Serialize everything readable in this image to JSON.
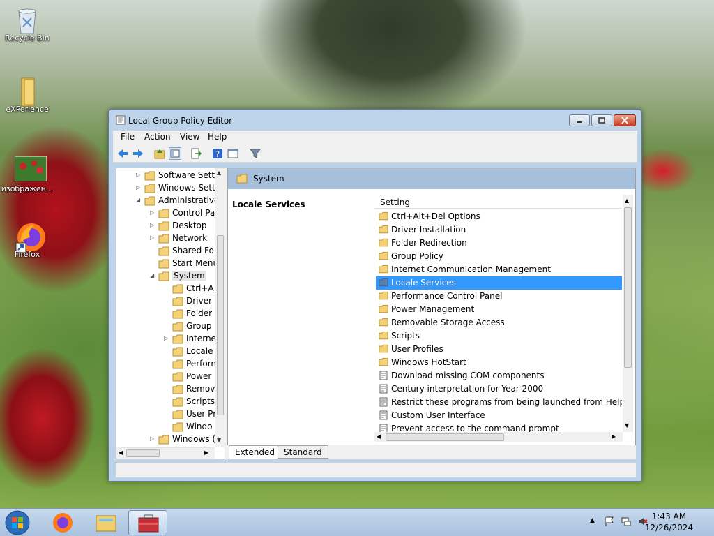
{
  "desktop": {
    "icons": [
      {
        "label": "Recycle Bin",
        "icon": "recycle-bin-icon"
      },
      {
        "label": "eXPerience",
        "icon": "folder-icon"
      },
      {
        "label": "изображен...",
        "icon": "image-icon"
      },
      {
        "label": "Firefox",
        "icon": "firefox-icon"
      }
    ]
  },
  "window": {
    "title": "Local Group Policy Editor",
    "menu": [
      "File",
      "Action",
      "View",
      "Help"
    ],
    "tree": [
      {
        "label": "Software Setti",
        "arrow": "▷"
      },
      {
        "label": "Windows Sett",
        "arrow": "▷"
      },
      {
        "label": "Administrative",
        "arrow": "◢"
      },
      {
        "label": "Control Pa",
        "arrow": "▷"
      },
      {
        "label": "Desktop",
        "arrow": "▷"
      },
      {
        "label": "Network",
        "arrow": "▷"
      },
      {
        "label": "Shared Fol",
        "arrow": ""
      },
      {
        "label": "Start Menu",
        "arrow": ""
      },
      {
        "label": "System",
        "arrow": "◢"
      },
      {
        "label": "Ctrl+A",
        "arrow": ""
      },
      {
        "label": "Driver",
        "arrow": ""
      },
      {
        "label": "Folder",
        "arrow": ""
      },
      {
        "label": "Group",
        "arrow": ""
      },
      {
        "label": "Interne",
        "arrow": "▷"
      },
      {
        "label": "Locale",
        "arrow": ""
      },
      {
        "label": "Perforn",
        "arrow": ""
      },
      {
        "label": "Power",
        "arrow": ""
      },
      {
        "label": "Remov",
        "arrow": ""
      },
      {
        "label": "Scripts",
        "arrow": ""
      },
      {
        "label": "User Pr",
        "arrow": ""
      },
      {
        "label": "Windo",
        "arrow": ""
      },
      {
        "label": "Windows (",
        "arrow": "▷"
      }
    ],
    "header_folder": "System",
    "selected_title": "Locale Services",
    "column_header": "Setting",
    "settings": [
      {
        "label": "Ctrl+Alt+Del Options",
        "type": "folder"
      },
      {
        "label": "Driver Installation",
        "type": "folder"
      },
      {
        "label": "Folder Redirection",
        "type": "folder"
      },
      {
        "label": "Group Policy",
        "type": "folder"
      },
      {
        "label": "Internet Communication Management",
        "type": "folder"
      },
      {
        "label": "Locale Services",
        "type": "folder",
        "selected": true
      },
      {
        "label": "Performance Control Panel",
        "type": "folder"
      },
      {
        "label": "Power Management",
        "type": "folder"
      },
      {
        "label": "Removable Storage Access",
        "type": "folder"
      },
      {
        "label": "Scripts",
        "type": "folder"
      },
      {
        "label": "User Profiles",
        "type": "folder"
      },
      {
        "label": "Windows HotStart",
        "type": "folder"
      },
      {
        "label": "Download missing COM components",
        "type": "policy"
      },
      {
        "label": "Century interpretation for Year 2000",
        "type": "policy"
      },
      {
        "label": "Restrict these programs from being launched from Help",
        "type": "policy"
      },
      {
        "label": "Custom User Interface",
        "type": "policy"
      },
      {
        "label": "Prevent access to the command prompt",
        "type": "policy"
      }
    ],
    "tabs": [
      "Extended",
      "Standard"
    ]
  },
  "taskbar": {
    "time": "1:43 AM",
    "date": "12/26/2024"
  }
}
